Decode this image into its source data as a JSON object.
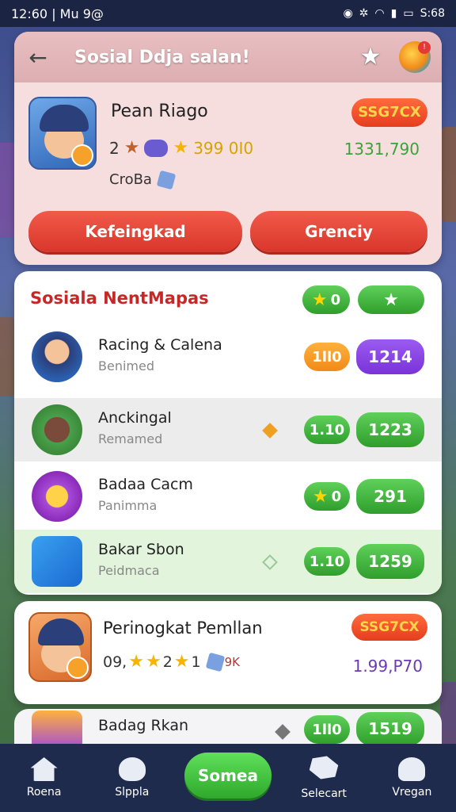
{
  "status": {
    "time": "12:60 | Mu 9@",
    "right": "S:68"
  },
  "header": {
    "title": "Sosial Ddja salan!"
  },
  "profile": {
    "name": "Pean Riago",
    "stat_a": "2",
    "stat_b": "399 0I0",
    "guild": "CroBa",
    "badge": "SSG7CX",
    "score": "1331,790"
  },
  "actions": {
    "left_label": "Kefeingkad",
    "right_label": "Grenciy"
  },
  "leaderboard": {
    "title": "Sosiala NentMapas",
    "pill_a": "0",
    "rows": [
      {
        "name": "Racing & Calena",
        "sub": "Benimed",
        "pill": "1ll0",
        "score": "1214"
      },
      {
        "name": "Anckingal",
        "sub": "Remamed",
        "pill": "1.10",
        "score": "1223"
      },
      {
        "name": "Badaa Cacm",
        "sub": "Panimma",
        "pill": "0",
        "score": "291"
      },
      {
        "name": "Bakar Sbon",
        "sub": "Peidmaca",
        "pill": "1.10",
        "score": "1259"
      }
    ]
  },
  "player_card": {
    "name": "Perinogkat Pemllan",
    "stats_a": "09,",
    "stats_b": "2",
    "stats_c": "1",
    "stats_d": "9K",
    "badge": "SSG7CX",
    "score": "1.99,P70"
  },
  "peek_row": {
    "name": "Badag Rkan",
    "pill": "1ll0",
    "score": "1519"
  },
  "nav": {
    "items": [
      "Roena",
      "Slppla",
      "Somea",
      "Selecart",
      "Vregan"
    ]
  },
  "colors": {
    "accent_red": "#d9362a",
    "accent_green": "#2f9e2c",
    "accent_purple": "#7a33d8"
  }
}
